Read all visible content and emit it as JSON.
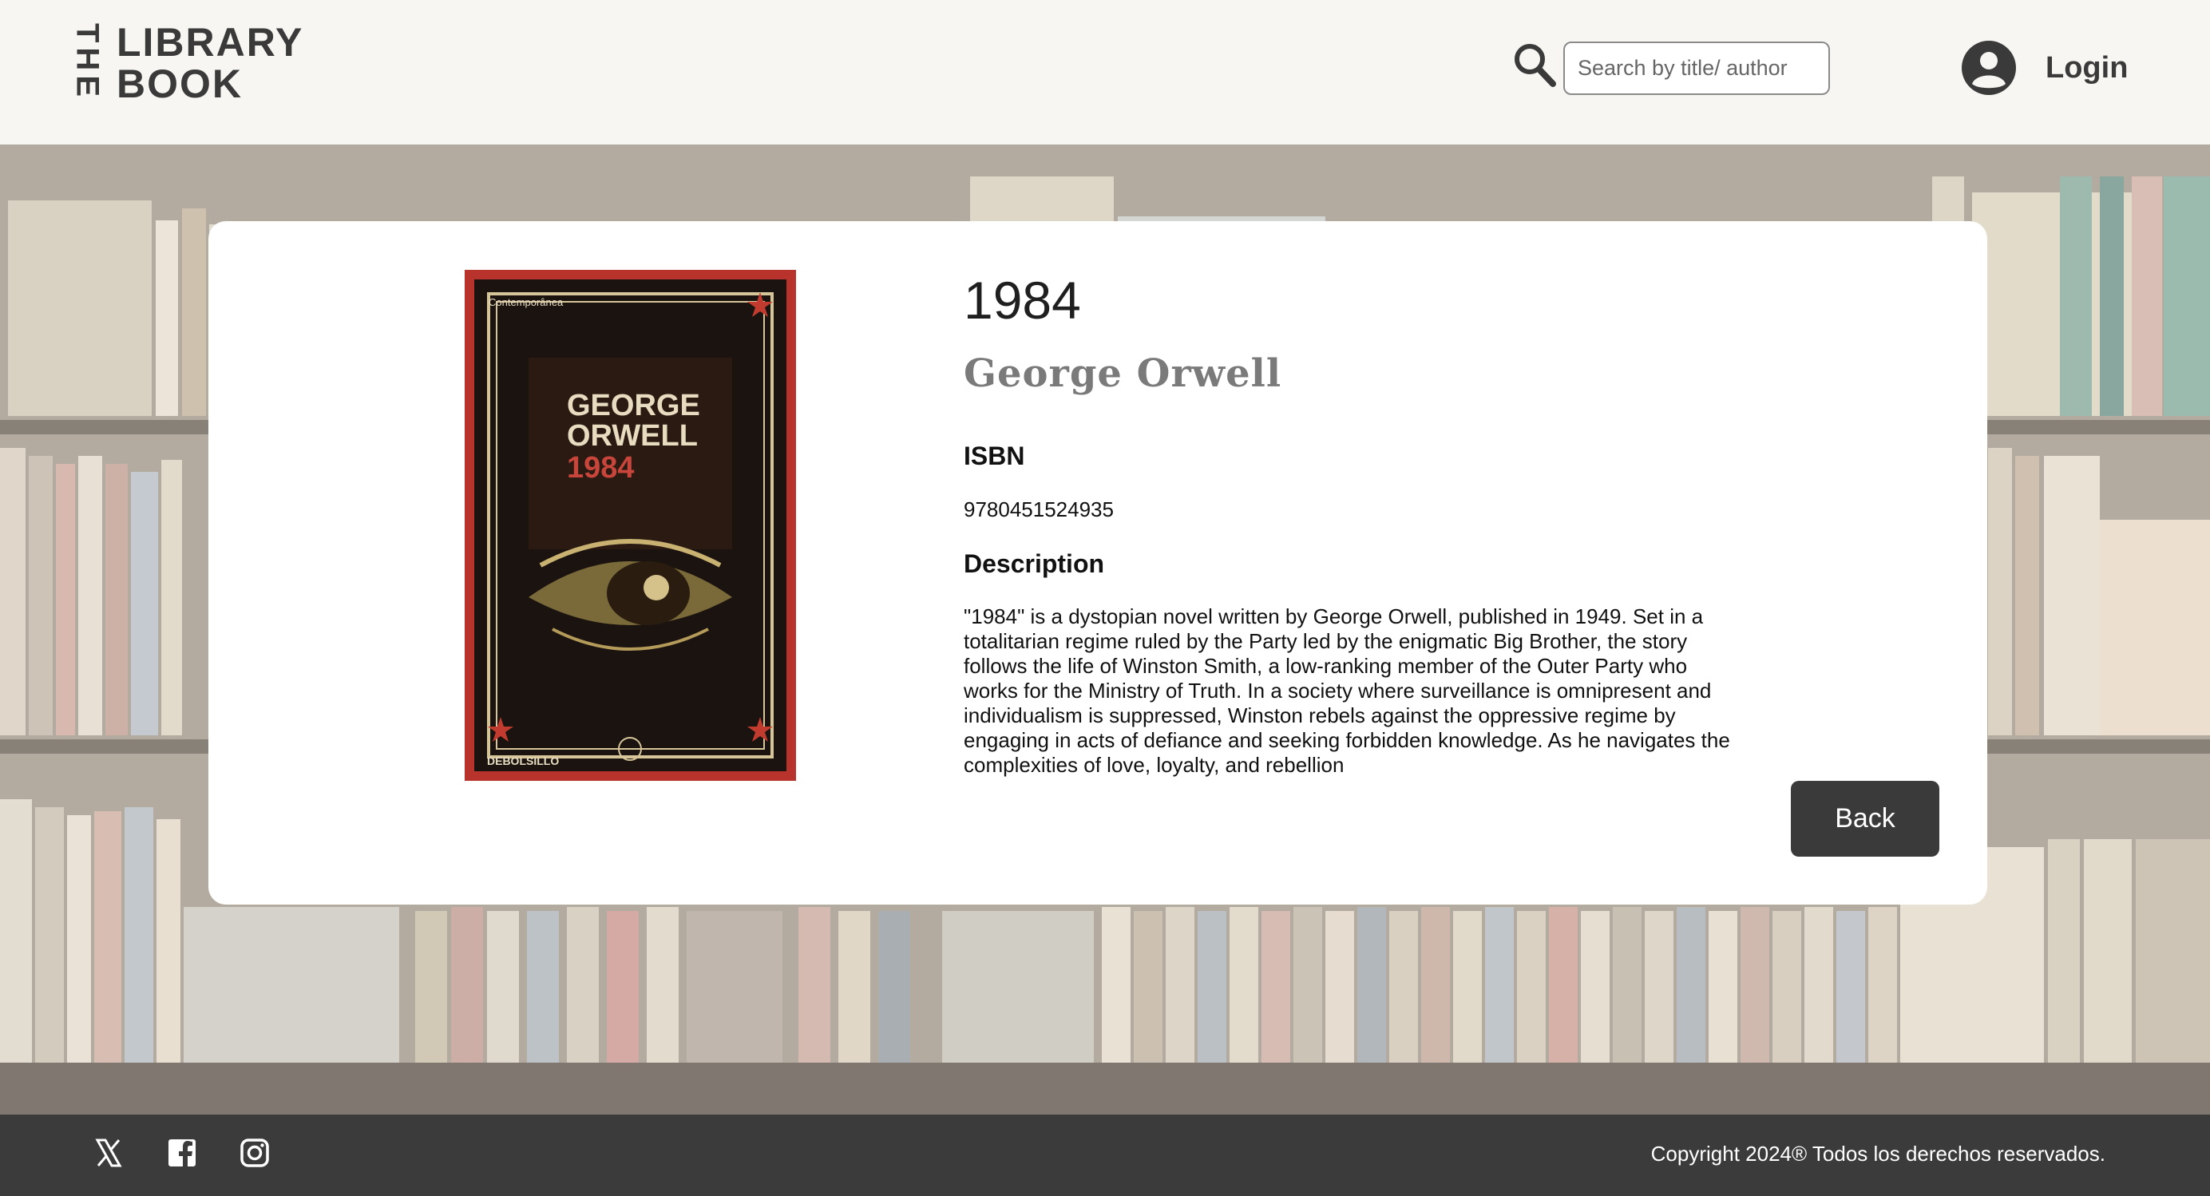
{
  "header": {
    "logo": {
      "the": "THE",
      "line1": "LIBRARY",
      "line2": "BOOK"
    },
    "search": {
      "placeholder": "Search by title/ author"
    },
    "login_label": "Login"
  },
  "book": {
    "title": "1984",
    "author": "George Orwell",
    "isbn_label": "ISBN",
    "isbn": "9780451524935",
    "description_label": "Description",
    "description": "\"1984\" is a dystopian novel written by George Orwell, published in 1949. Set in a totalitarian regime ruled by the Party led by the enigmatic Big Brother, the story follows the life of Winston Smith, a low-ranking member of the Outer Party who works for the Ministry of Truth. In a society where surveillance is omnipresent and individualism is suppressed, Winston rebels against the oppressive regime by engaging in acts of defiance and seeking forbidden knowledge. As he navigates the complexities of love, loyalty, and rebellion",
    "cover": {
      "publisher_top": "Contemporânea",
      "author_line1": "GEORGE",
      "author_line2": "ORWELL",
      "title": "1984",
      "publisher_bottom": "DEBOLSILLO"
    }
  },
  "actions": {
    "back_label": "Back"
  },
  "footer": {
    "social": [
      "x-icon",
      "facebook-icon",
      "instagram-icon"
    ],
    "copyright": "Copyright 2024® Todos los derechos reservados."
  },
  "colors": {
    "header_bg": "#f7f6f3",
    "footer_bg": "#3c3b3b",
    "button_bg": "#3b3a3a",
    "text_dark": "#3a3a3a"
  }
}
